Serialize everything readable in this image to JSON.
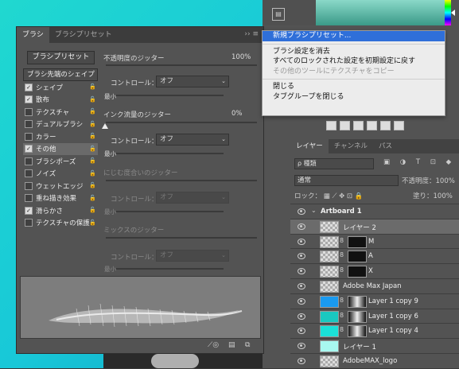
{
  "brush_panel": {
    "tabs": [
      "ブラシ",
      "ブラシプリセット"
    ],
    "tab_controls": "›› ≡",
    "preset_button": "ブラシプリセット",
    "tip_shape_header": "ブラシ先端のシェイプ",
    "side_items": [
      {
        "label": "シェイプ",
        "checked": true,
        "locked": true
      },
      {
        "label": "散布",
        "checked": true,
        "locked": true
      },
      {
        "label": "テクスチャ",
        "checked": false,
        "locked": true
      },
      {
        "label": "デュアルブラシ",
        "checked": false,
        "locked": true
      },
      {
        "label": "カラー",
        "checked": false,
        "locked": true
      },
      {
        "label": "その他",
        "checked": true,
        "locked": true,
        "selected": true
      },
      {
        "label": "ブラシポーズ",
        "checked": false,
        "locked": true
      },
      {
        "label": "ノイズ",
        "checked": false,
        "locked": true
      },
      {
        "label": "ウェットエッジ",
        "checked": false,
        "locked": true
      },
      {
        "label": "重ね描き効果",
        "checked": false,
        "locked": true
      },
      {
        "label": "滑らかさ",
        "checked": true,
        "locked": true
      },
      {
        "label": "テクスチャの保護",
        "checked": false,
        "locked": true
      }
    ],
    "opacity_jitter_label": "不透明度のジッター",
    "opacity_jitter_value": "100%",
    "control_label": "コントロール：",
    "control_value_1": "オフ",
    "minimum_label": "最小",
    "flow_jitter_label": "インク流量のジッター",
    "flow_jitter_value": "0%",
    "control_value_2": "オフ",
    "wet_jitter_label": "にじむ度合いのジッター",
    "control_value_3": "オフ",
    "mix_jitter_label": "ミックスのジッター",
    "control_value_4": "オフ",
    "bottom_icons": [
      "⟋◎",
      "▤",
      "⧉"
    ]
  },
  "flyout_menu": {
    "items": [
      {
        "label": "新規ブラシプリセット...",
        "highlighted": true
      },
      {
        "separator": true
      },
      {
        "label": "ブラシ設定を消去"
      },
      {
        "label": "すべてのロックされた設定を初期設定に戻す"
      },
      {
        "label": "その他のツールにテクスチャをコピー",
        "disabled": true
      },
      {
        "separator": true
      },
      {
        "label": "閉じる"
      },
      {
        "label": "タブグループを閉じる"
      }
    ]
  },
  "layers_panel": {
    "tabs": [
      "レイヤー",
      "チャンネル",
      "パス"
    ],
    "filter_kind": "ρ 種類",
    "filter_icons": "▣ ◑ T ⊡ ◆",
    "blend_mode": "通常",
    "opacity_label": "不透明度：",
    "opacity_value": "100%",
    "lock_label": "ロック：",
    "lock_icons": "▦ ⟋ ✥ ⊡ 🔒",
    "fill_label": "塗り：",
    "fill_value": "100%",
    "layers": [
      {
        "name": "Artboard 1",
        "type": "artboard"
      },
      {
        "name": "レイヤー 2",
        "thumb": "checker",
        "selected": true
      },
      {
        "name": "M",
        "thumb": "checker",
        "mask": true
      },
      {
        "name": "A",
        "thumb": "checker",
        "mask": true
      },
      {
        "name": "X",
        "thumb": "checker",
        "mask": true
      },
      {
        "name": "Adobe Max Japan",
        "thumb": "checker"
      },
      {
        "name": "Layer 1 copy 9",
        "thumb": "#1a9af0",
        "mask": true
      },
      {
        "name": "Layer 1 copy 6",
        "thumb": "#1ac8c0",
        "mask": true
      },
      {
        "name": "Layer 1 copy 4",
        "thumb": "#1ae0d8",
        "mask": true
      },
      {
        "name": "レイヤー 1",
        "thumb": "#a8f8f0"
      },
      {
        "name": "AdobeMAX_logo",
        "thumb": "checker"
      }
    ]
  },
  "colors": {
    "highlight": "#2f6fd9",
    "panel": "#535353",
    "canvas": "#20d8d0"
  }
}
